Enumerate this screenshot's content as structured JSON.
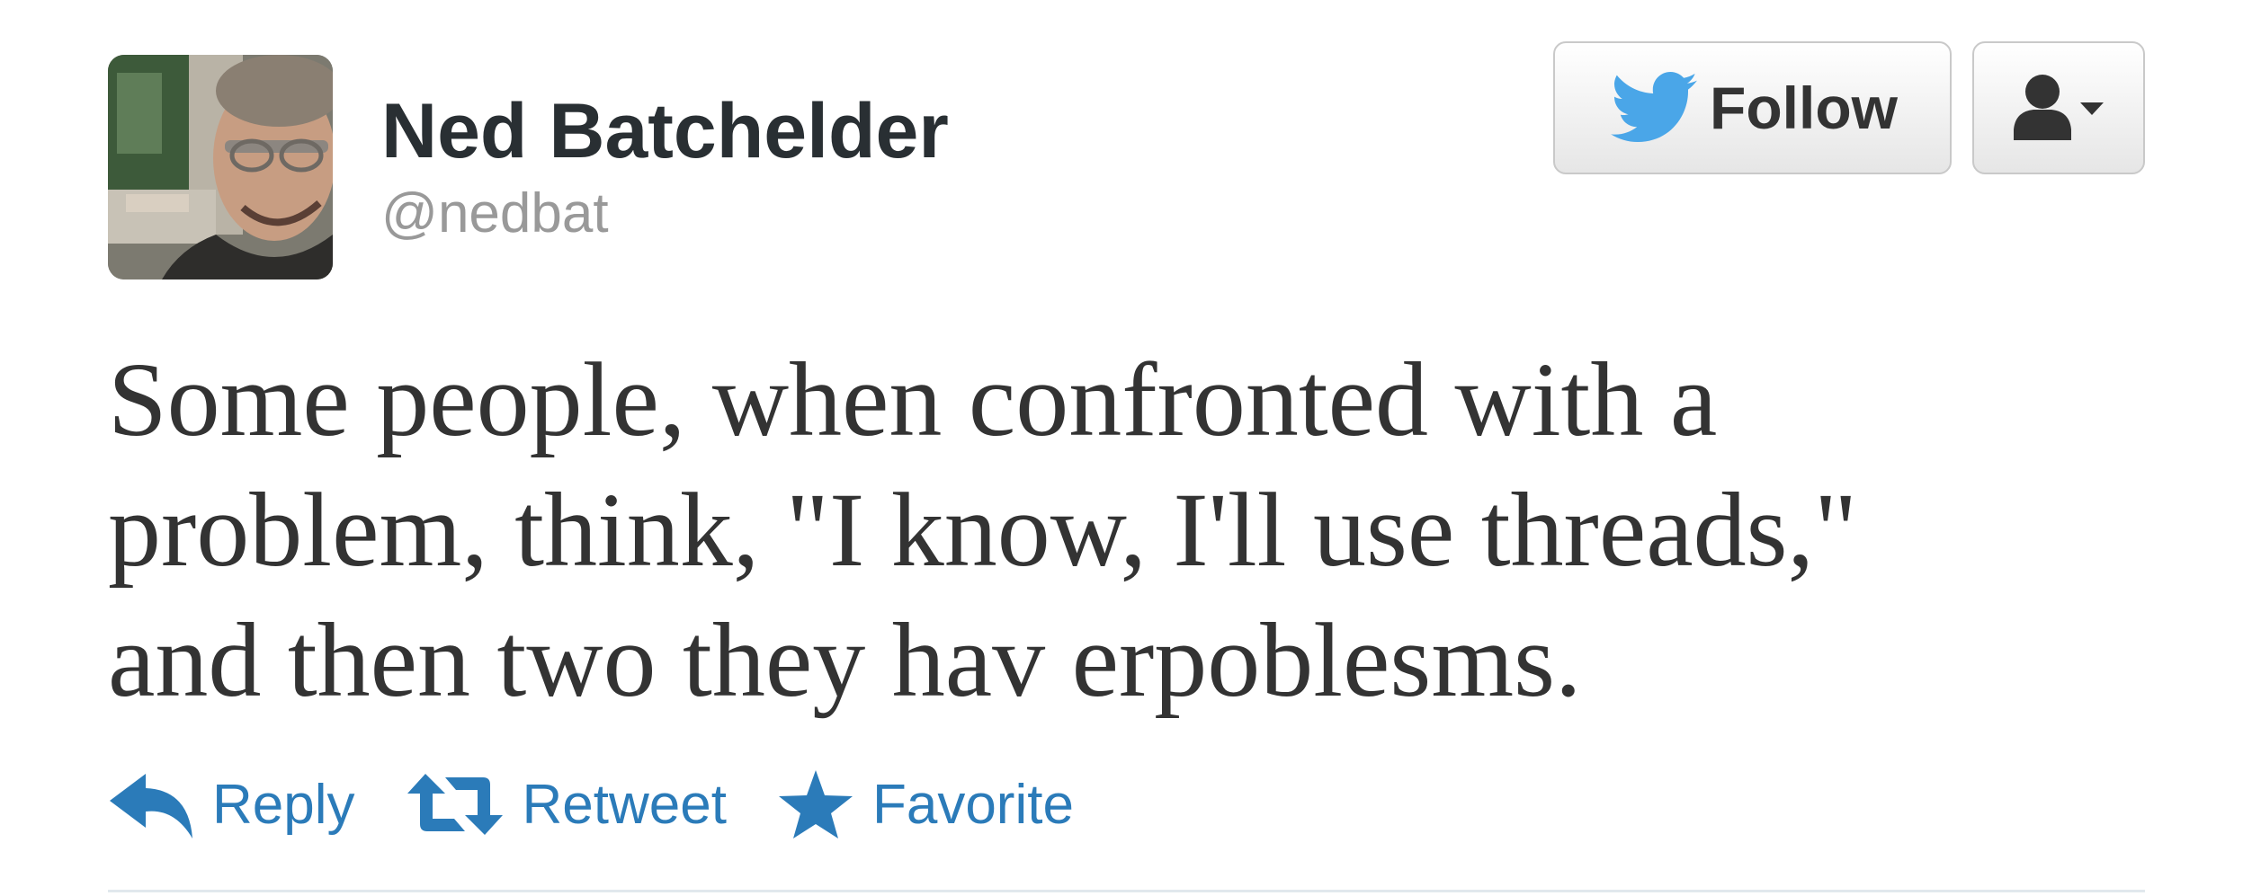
{
  "tweet": {
    "author": {
      "display_name": "Ned Batchelder",
      "screen_name": "@nedbat"
    },
    "text": "Some people, when confronted with a\nproblem, think, \"I know, I'll use threads,\"\nand then two they hav erpoblesms.",
    "follow_button": {
      "label": "Follow",
      "icon": "twitter-bird-icon"
    },
    "user_menu_button": {
      "icon": "user-dropdown-icon"
    },
    "actions": [
      {
        "label": "Reply",
        "icon": "reply-arrow-icon"
      },
      {
        "label": "Retweet",
        "icon": "retweet-icon"
      },
      {
        "label": "Favorite",
        "icon": "star-icon"
      }
    ]
  },
  "colors": {
    "action_blue": "#2b7bb9",
    "follow_bird": "#4aa6e8",
    "name_text": "#292f33",
    "handle_text": "#999999",
    "body_text": "#333333"
  }
}
